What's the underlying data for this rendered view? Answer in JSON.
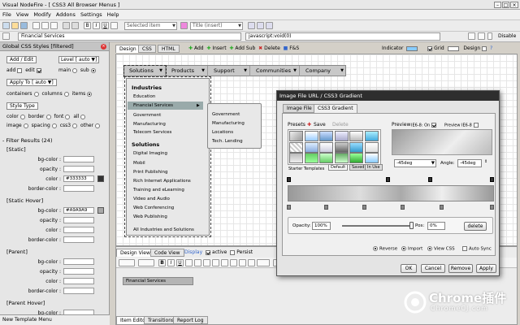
{
  "window": {
    "title": "Visual NodeFire - [ CSS3 All Browser Menus ]"
  },
  "menubar": [
    "File",
    "View",
    "Modify",
    "Addons",
    "Settings",
    "Help"
  ],
  "toolbar1": {
    "selected_item_placeholder": "Selected item",
    "title_placeholder": "Title (insert)"
  },
  "toolbar2": {
    "item_name": "Financial Services",
    "link": "javascript:void(0)",
    "disable": "Disable"
  },
  "left_panel": {
    "title": "Global CSS Styles [filtered]",
    "add_edit": "Add / Edit",
    "level": "Level",
    "level_value": "auto",
    "add": "add",
    "edit": "edit",
    "main": "main",
    "sub": "sub",
    "apply_to": "Apply To",
    "apply_to_value": "auto",
    "containers": "containers",
    "columns": "columns",
    "items": "items",
    "style_type": "Style Type",
    "color": "color",
    "border": "border",
    "font": "font",
    "all": "all",
    "image": "image",
    "spacing": "spacing",
    "css3": "css3",
    "other": "other",
    "filter_results": "Filter Results",
    "filter_count": "(24)",
    "sections": [
      {
        "name": "[Static]",
        "props": [
          {
            "k": "bg-color :",
            "v": ""
          },
          {
            "k": "opacity :",
            "v": ""
          },
          {
            "k": "color :",
            "v": "#333333",
            "sw": "#333333"
          },
          {
            "k": "border-color :",
            "v": ""
          }
        ]
      },
      {
        "name": "[Static Hover]",
        "props": [
          {
            "k": "bg-color :",
            "v": "#A9A9A9",
            "sw": "#a9a9a9"
          },
          {
            "k": "opacity :",
            "v": ""
          },
          {
            "k": "color :",
            "v": ""
          },
          {
            "k": "border-color :",
            "v": ""
          }
        ]
      },
      {
        "name": "[Parent]",
        "props": [
          {
            "k": "bg-color :",
            "v": ""
          },
          {
            "k": "opacity :",
            "v": ""
          },
          {
            "k": "color :",
            "v": ""
          },
          {
            "k": "border-color :",
            "v": ""
          }
        ]
      },
      {
        "name": "[Parent Hover]",
        "props": [
          {
            "k": "bg-color :",
            "v": ""
          },
          {
            "k": "opacity :",
            "v": ""
          }
        ]
      }
    ],
    "footer": "New Template Menu"
  },
  "view_tabs": [
    "Design",
    "CSS",
    "HTML"
  ],
  "design_toolbar": {
    "add": "Add",
    "insert": "Insert",
    "add_sub": "Add Sub",
    "delete": "Delete",
    "fs": "F&S",
    "indicator": "Indicator",
    "grid": "Grid",
    "design": "Design"
  },
  "nav": [
    "Solutions",
    "Products",
    "Support",
    "Communities",
    "Company"
  ],
  "dropdown": {
    "industries_head": "Industries",
    "industries": [
      "Education",
      "Financial Services",
      "Government",
      "Manufacturing",
      "Telecom Services"
    ],
    "solutions_head": "Solutions",
    "solutions": [
      "Digital Imaging",
      "Mobil",
      "Print Publishing",
      "Rich Internet Applications",
      "Training and eLearning",
      "Video and Audio",
      "Web Conferencing",
      "Web Publishing"
    ],
    "footer": "All Industries and Solutions"
  },
  "submenu": [
    "Government",
    "Manufacturing",
    "Locations",
    "Tech. Lending"
  ],
  "bottom": {
    "tabs": [
      "Design View",
      "Code View"
    ],
    "display": "Display",
    "active": "active",
    "persist": "Persist",
    "preview_item": "Financial Services",
    "footer_tabs": [
      "Item Editor",
      "Transitions",
      "Report Log"
    ]
  },
  "dialog": {
    "title": "Image File URL / CSS3 Gradient",
    "tabs": [
      "Image File",
      "CSS3 Gradient"
    ],
    "presets": "Presets",
    "save": "Save",
    "delete": "Delete",
    "preview": "Preview",
    "ie9": "IE6-8: On",
    "preview_ie": "Preview IE6-8",
    "starter_templates": "Starter Templates",
    "default": "Default",
    "saved": "Saved",
    "in_use": "In Use",
    "direction": "-45deg",
    "angle_label": "Angle:",
    "angle_value": "-45deg",
    "opacity_label": "Opacity:",
    "opacity_value": "100%",
    "pos_label": "Pos:",
    "pos_value": "0%",
    "delete_btn": "delete",
    "reverse": "Reverse",
    "import": "Import",
    "view_css": "View CSS",
    "auto_sync": "Auto Sync",
    "ok": "OK",
    "cancel": "Cancel",
    "remove": "Remove",
    "apply": "Apply"
  },
  "watermark": {
    "brand": "Chrome插件",
    "sub": "ChromeCJ.com"
  }
}
